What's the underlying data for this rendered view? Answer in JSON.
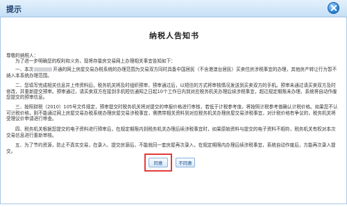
{
  "window": {
    "title": "提示",
    "close_icon": "close-icon"
  },
  "notice": {
    "title": "纳税人告知书",
    "greeting": "尊敬的纳税人：",
    "intro": "为了进一步明确您的权利和义务，现将存量房交易网上办理相关事宜告知如下：",
    "p1_a": "一、本次",
    "p1_b": "开通的网上房屋交易办税系统的办理范围为交易双方同时具备中国居民（不含港澳台居民）买卖住房涉税事宜的办理，其他房产转让行为暂不纳入本系统办理范围。",
    "p2": "二、您填写完成相关信息并上传资料后，税务机关将及时组织预审，预审通过后，以短信的方式将审核情况发送到买卖双方的手机。预审未通过请买卖双方及时修改，并重新提交预审。预审通过，请买卖双方在接到手机短信通知之日起10个工作日内到对应税务机关办理后续涉税事宜，超过规定期限未办理，系统将自动作废您提交的预审信息。",
    "p3": "三、按照财税〔2010〕105号文件规定，预审提交时税务机关将对提交的申报价格进行审核，若低于计税参考值，将按照计税参考值确认计税价格。如果您不认可计税价格，则不能通过网上房屋交易办税系统办理房屋交易涉税事宜，需携带相关资料到对应税务机关办理房屋交易涉税事宜，对计税价格有争议的，税务机关将受理议价申请进行审查。",
    "p4": "四、税务机关根据您提交的电子资料进行预审后，在规定期限内到税务机关办理后续涉税事宜时，如果原始资料与提交的电子资料不相符，税务机关有权对本次交易信息进行重新审核。",
    "p5": "五、为了节约资源，防止不真实交易，在录入、提交房源后，不能就同一套房屋再次录入，在规定期限内办理后续涉税事宜，系统自动作废后，方能再次录入提交。"
  },
  "buttons": {
    "agree": "同意",
    "disagree": "不同意"
  }
}
